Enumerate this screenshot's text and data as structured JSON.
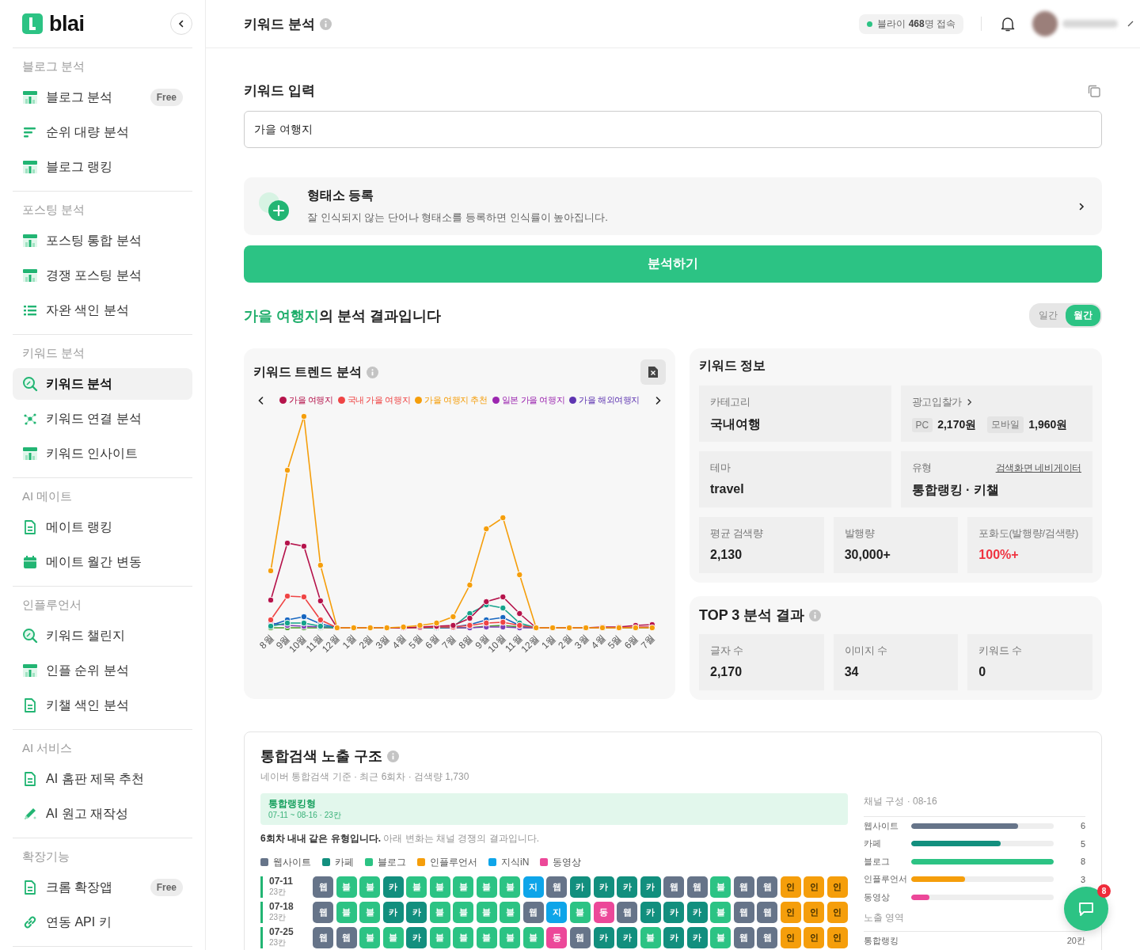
{
  "sidebar": {
    "brand": "blai",
    "sections": [
      {
        "title": "블로그 분석",
        "items": [
          {
            "label": "블로그 분석",
            "selected": false,
            "badge": "Free"
          },
          {
            "label": "순위 대량 분석",
            "selected": false
          },
          {
            "label": "블로그 랭킹",
            "selected": false
          }
        ]
      },
      {
        "title": "포스팅 분석",
        "items": [
          {
            "label": "포스팅 통합 분석",
            "selected": false
          },
          {
            "label": "경쟁 포스팅 분석",
            "selected": false
          },
          {
            "label": "자완 색인 분석",
            "selected": false
          }
        ]
      },
      {
        "title": "키워드 분석",
        "items": [
          {
            "label": "키워드 분석",
            "selected": true
          },
          {
            "label": "키워드 연결 분석",
            "selected": false
          },
          {
            "label": "키워드 인사이트",
            "selected": false
          }
        ]
      },
      {
        "title": "AI 메이트",
        "items": [
          {
            "label": "메이트 랭킹",
            "selected": false
          },
          {
            "label": "메이트 월간 변동",
            "selected": false
          }
        ]
      },
      {
        "title": "인플루언서",
        "items": [
          {
            "label": "키워드 챌린지",
            "selected": false
          },
          {
            "label": "인플 순위 분석",
            "selected": false
          },
          {
            "label": "키챌 색인 분석",
            "selected": false
          }
        ]
      },
      {
        "title": "AI 서비스",
        "items": [
          {
            "label": "AI 홈판 제목 추천",
            "selected": false
          },
          {
            "label": "AI 원고 재작성",
            "selected": false
          }
        ]
      },
      {
        "title": "확장기능",
        "items": [
          {
            "label": "크롬 확장앱",
            "selected": false,
            "badge": "Free"
          },
          {
            "label": "연동 API 키",
            "selected": false
          }
        ]
      }
    ]
  },
  "header": {
    "title": "키워드 분석",
    "online": "블라이 **468**명 접속"
  },
  "keyword_input": {
    "title": "키워드 입력",
    "value": "가을 여행지"
  },
  "morpheme": {
    "title": "형태소 등록",
    "description": "잘 인식되지 않는 단어나 형태소를 등록하면 인식률이 높아집니다."
  },
  "analyze_button": "분석하기",
  "result": {
    "keyword": "가을 여행지",
    "suffix": "의 분석 결과입니다",
    "periods": [
      {
        "label": "일간",
        "selected": false
      },
      {
        "label": "월간",
        "selected": true
      }
    ]
  },
  "trend": {
    "title": "키워드 트렌드 분석",
    "legend": [
      {
        "label": "가을 여행지",
        "color": "#b5134b"
      },
      {
        "label": "국내 가을 여행지",
        "color": "#ef4444"
      },
      {
        "label": "가을 여행지 추천",
        "color": "#f59e0b"
      },
      {
        "label": "일본 가을 여행지",
        "color": "#9c27b0"
      },
      {
        "label": "가을 해외여행지",
        "color": "#5e35b1"
      }
    ],
    "x_labels": [
      "8월",
      "9월",
      "10월",
      "11월",
      "12월",
      "1월",
      "2월",
      "3월",
      "4월",
      "5월",
      "6월",
      "7월",
      "8월",
      "9월",
      "10월",
      "11월",
      "12월",
      "1월",
      "2월",
      "3월",
      "4월",
      "5월",
      "6월",
      "7월"
    ]
  },
  "info": {
    "title": "키워드 정보",
    "category": {
      "label": "카테고리",
      "value": "국내여행"
    },
    "ad_bid": {
      "label": "광고입찰가",
      "pc_label": "PC",
      "pc_value": "2,170원",
      "mobile_label": "모바일",
      "mobile_value": "1,960원"
    },
    "theme": {
      "label": "테마",
      "value": "travel"
    },
    "type": {
      "label": "유형",
      "link": "검색화면 네비게이터",
      "value": "통합랭킹 · 키챌"
    },
    "stats": [
      {
        "label": "평균 검색량",
        "value": "2,130",
        "highlight": false
      },
      {
        "label": "발행량",
        "value": "30,000+",
        "highlight": false
      },
      {
        "label": "포화도(발행량/검색량)",
        "value": "100%+",
        "highlight": true
      }
    ]
  },
  "top3": {
    "title": "TOP 3 분석 결과",
    "stats": [
      {
        "label": "글자 수",
        "value": "2,170"
      },
      {
        "label": "이미지 수",
        "value": "34"
      },
      {
        "label": "키워드 수",
        "value": "0"
      }
    ]
  },
  "exposure": {
    "title": "통합검색 노출 구조",
    "subtitle": "네이버 통합검색 기준 · 최근 6회차 · 검색량 1,730",
    "banner": {
      "title": "통합랭킹형",
      "range": "07-11 ~ 08-16 · 23칸"
    },
    "note": "**6회차 내내 같은 유형입니다.** 아래 변화는 채널 경쟁의 결과입니다.",
    "channels": [
      {
        "kind": "web",
        "label": "웹사이트",
        "color": "#667489"
      },
      {
        "kind": "cafe",
        "label": "카페",
        "color": "#128f7e"
      },
      {
        "kind": "blog",
        "label": "블로그",
        "color": "#2cc384"
      },
      {
        "kind": "influencer",
        "label": "인플루언서",
        "color": "#f59e0b"
      },
      {
        "kind": "kin",
        "label": "지식iN",
        "color": "#0ea5e9"
      },
      {
        "kind": "video",
        "label": "동영상",
        "color": "#ec4899"
      }
    ],
    "rows": [
      {
        "date": "07-11",
        "count": "23칸",
        "cells": [
          {
            "text": "웹",
            "kind": "web"
          },
          {
            "text": "블",
            "kind": "blog"
          },
          {
            "text": "블",
            "kind": "blog"
          },
          {
            "text": "카",
            "kind": "cafe"
          },
          {
            "text": "블",
            "kind": "blog"
          },
          {
            "text": "블",
            "kind": "blog"
          },
          {
            "text": "블",
            "kind": "blog"
          },
          {
            "text": "블",
            "kind": "blog"
          },
          {
            "text": "블",
            "kind": "blog"
          },
          {
            "text": "지",
            "kind": "kin"
          },
          {
            "text": "웹",
            "kind": "web"
          },
          {
            "text": "카",
            "kind": "cafe"
          },
          {
            "text": "카",
            "kind": "cafe"
          },
          {
            "text": "카",
            "kind": "cafe"
          },
          {
            "text": "카",
            "kind": "cafe"
          },
          {
            "text": "웹",
            "kind": "web"
          },
          {
            "text": "웹",
            "kind": "web"
          },
          {
            "text": "블",
            "kind": "blog"
          },
          {
            "text": "웹",
            "kind": "web"
          },
          {
            "text": "웹",
            "kind": "web"
          },
          {
            "text": "인",
            "kind": "influencer"
          },
          {
            "text": "인",
            "kind": "influencer"
          },
          {
            "text": "인",
            "kind": "influencer"
          }
        ]
      },
      {
        "date": "07-18",
        "count": "23칸",
        "cells": [
          {
            "text": "웹",
            "kind": "web"
          },
          {
            "text": "블",
            "kind": "blog"
          },
          {
            "text": "블",
            "kind": "blog"
          },
          {
            "text": "카",
            "kind": "cafe"
          },
          {
            "text": "카",
            "kind": "cafe"
          },
          {
            "text": "블",
            "kind": "blog"
          },
          {
            "text": "블",
            "kind": "blog"
          },
          {
            "text": "블",
            "kind": "blog"
          },
          {
            "text": "블",
            "kind": "blog"
          },
          {
            "text": "웹",
            "kind": "web"
          },
          {
            "text": "지",
            "kind": "kin"
          },
          {
            "text": "블",
            "kind": "blog"
          },
          {
            "text": "동",
            "kind": "video"
          },
          {
            "text": "웹",
            "kind": "web"
          },
          {
            "text": "카",
            "kind": "cafe"
          },
          {
            "text": "카",
            "kind": "cafe"
          },
          {
            "text": "카",
            "kind": "cafe"
          },
          {
            "text": "블",
            "kind": "blog"
          },
          {
            "text": "웹",
            "kind": "web"
          },
          {
            "text": "웹",
            "kind": "web"
          },
          {
            "text": "인",
            "kind": "influencer"
          },
          {
            "text": "인",
            "kind": "influencer"
          },
          {
            "text": "인",
            "kind": "influencer"
          }
        ]
      },
      {
        "date": "07-25",
        "count": "23칸",
        "cells": [
          {
            "text": "웹",
            "kind": "web"
          },
          {
            "text": "웹",
            "kind": "web"
          },
          {
            "text": "블",
            "kind": "blog"
          },
          {
            "text": "블",
            "kind": "blog"
          },
          {
            "text": "카",
            "kind": "cafe"
          },
          {
            "text": "블",
            "kind": "blog"
          },
          {
            "text": "블",
            "kind": "blog"
          },
          {
            "text": "블",
            "kind": "blog"
          },
          {
            "text": "블",
            "kind": "blog"
          },
          {
            "text": "블",
            "kind": "blog"
          },
          {
            "text": "동",
            "kind": "video"
          },
          {
            "text": "웹",
            "kind": "web"
          },
          {
            "text": "카",
            "kind": "cafe"
          },
          {
            "text": "카",
            "kind": "cafe"
          },
          {
            "text": "블",
            "kind": "blog"
          },
          {
            "text": "카",
            "kind": "cafe"
          },
          {
            "text": "카",
            "kind": "cafe"
          },
          {
            "text": "블",
            "kind": "blog"
          },
          {
            "text": "웹",
            "kind": "web"
          },
          {
            "text": "웹",
            "kind": "web"
          },
          {
            "text": "인",
            "kind": "influencer"
          },
          {
            "text": "인",
            "kind": "influencer"
          },
          {
            "text": "인",
            "kind": "influencer"
          }
        ]
      }
    ],
    "composition": {
      "title": "채널 구성 · 08-16",
      "items": [
        {
          "kind": "web",
          "label": "웹사이트",
          "level": 0.75,
          "reading": "6"
        },
        {
          "kind": "cafe",
          "label": "카페",
          "level": 0.63,
          "reading": "5"
        },
        {
          "kind": "blog",
          "label": "블로그",
          "level": 1,
          "reading": "8"
        },
        {
          "kind": "influencer",
          "label": "인플루언서",
          "level": 0.38,
          "reading": "3"
        },
        {
          "kind": "video",
          "label": "동영상",
          "level": 0.13
        }
      ]
    },
    "area": {
      "title": "노출 영역",
      "rows": [
        {
          "label": "통합랭킹",
          "value": "20칸"
        }
      ]
    }
  },
  "chat": {
    "badge": "8"
  }
}
